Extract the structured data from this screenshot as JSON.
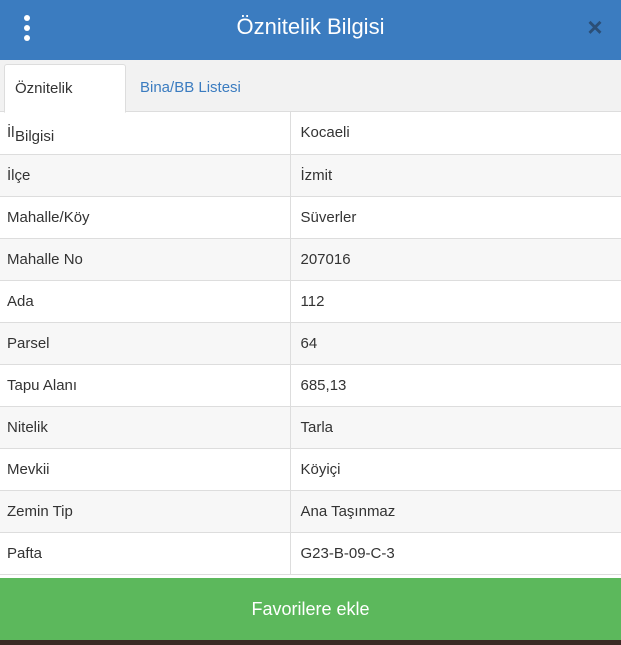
{
  "header": {
    "title": "Öznitelik Bilgisi",
    "close_symbol": "×"
  },
  "tabs": [
    {
      "label": "Öznitelik Bilgisi",
      "active": true
    },
    {
      "label": "Bina/BB Listesi",
      "active": false
    }
  ],
  "rows": [
    {
      "key": "İl",
      "value": "Kocaeli"
    },
    {
      "key": "İlçe",
      "value": "İzmit"
    },
    {
      "key": "Mahalle/Köy",
      "value": "Süverler"
    },
    {
      "key": "Mahalle No",
      "value": "207016"
    },
    {
      "key": "Ada",
      "value": "112"
    },
    {
      "key": "Parsel",
      "value": "64"
    },
    {
      "key": "Tapu Alanı",
      "value": "685,13"
    },
    {
      "key": "Nitelik",
      "value": "Tarla"
    },
    {
      "key": "Mevkii",
      "value": "Köyiçi"
    },
    {
      "key": "Zemin Tip",
      "value": "Ana Taşınmaz"
    },
    {
      "key": "Pafta",
      "value": "G23-B-09-C-3"
    }
  ],
  "footer": {
    "button_label": "Favorilere ekle"
  },
  "colors": {
    "header": "#3b7cc0",
    "button": "#5cb85c",
    "tab_link": "#3b7cc0"
  }
}
